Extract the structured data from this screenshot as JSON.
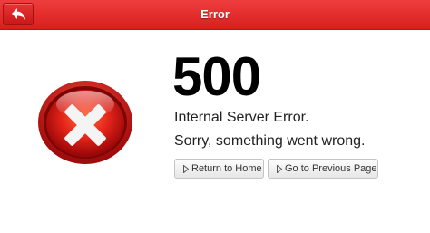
{
  "header": {
    "title": "Error",
    "back_icon": "back-arrow-icon",
    "color": "#e02b2b"
  },
  "error": {
    "code": "500",
    "title": "Internal Server Error.",
    "message": "Sorry, something went wrong.",
    "icon": "error-x-icon",
    "icon_color": "#e3241a"
  },
  "actions": {
    "home_label": "Return to Home",
    "previous_label": "Go to Previous Page"
  }
}
